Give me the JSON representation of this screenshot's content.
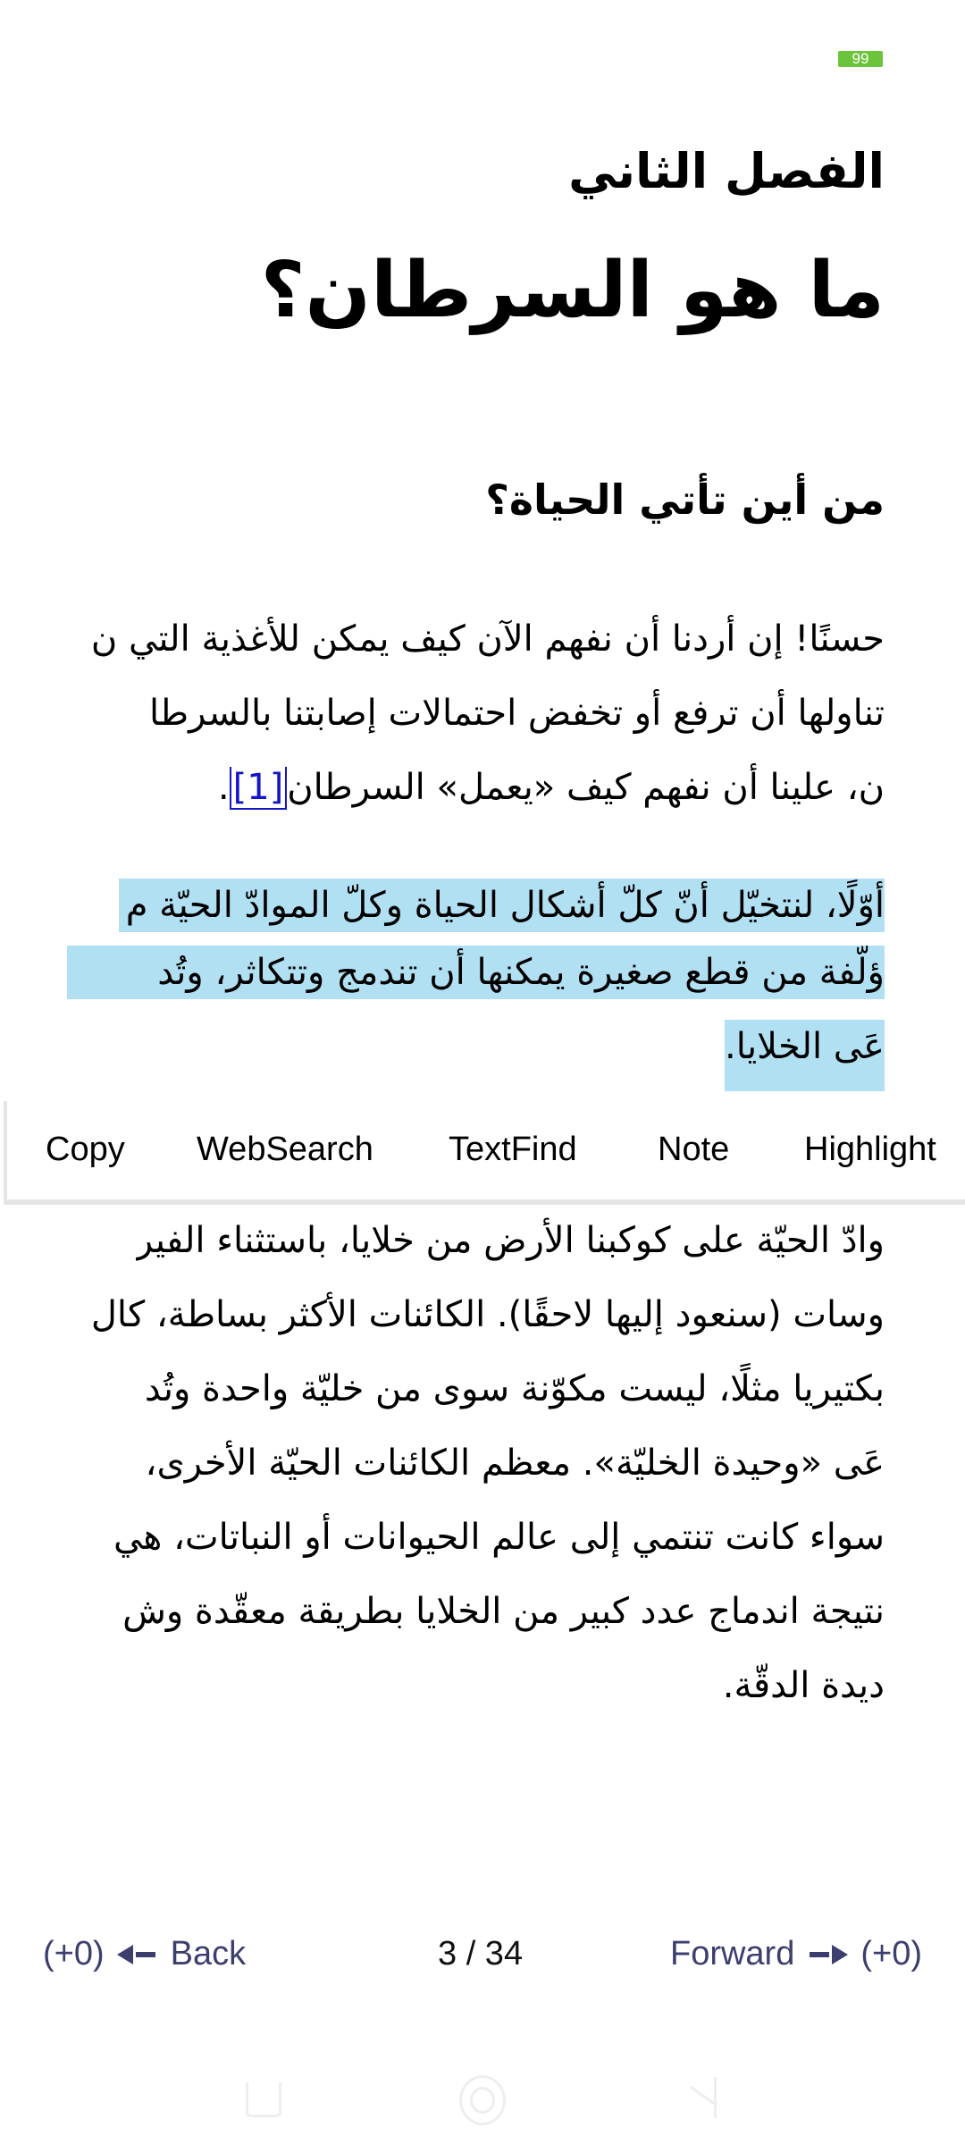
{
  "status": {
    "battery": "99",
    "battery_color": "#6cc43a"
  },
  "book": {
    "chapter_label": "الفصل الثاني",
    "chapter_title": "ما هو السرطان؟",
    "section_title": "من أين تأتي الحياة؟",
    "paragraph1": [
      "حسنًا! إن أردنا أن نفهم الآن كيف يمكن للأغذية التي ن",
      "تناولها أن ترفع أو تخفض احتمالات إصابتنا بالسرطا",
      "ن، علينا أن نفهم كيف «يعمل» السرطان"
    ],
    "footnote_ref": "[1]",
    "footnote_trailing": ".",
    "paragraph2_selected": [
      "أوّلًا، لنتخيّل أنّ كلّ أشكال الحياة وكلّ الموادّ الحيّة م",
      "ؤلّفة من قطع صغيرة يمكنها أن تندمج وتتكاثر، وتُد",
      "عَى الخلايا."
    ],
    "paragraph3": [
      "وادّ الحيّة على كوكبنا الأرض من خلايا، باستثناء الفير",
      "وسات (سنعود إليها لاحقًا). الكائنات الأكثر بساطة، كال",
      "بكتيريا مثلًا، ليست مكوّنة سوى من خليّة واحدة وتُد",
      "عَى «وحيدة الخليّة». معظم الكائنات الحيّة الأخرى،",
      "سواء كانت تنتمي إلى عالم الحيوانات أو النباتات، هي",
      "نتيجة اندماج عدد كبير من الخلايا بطريقة معقّدة وش",
      "ديدة الدقّة."
    ],
    "selection_color": "#b1e0f3",
    "link_color": "#1515c8"
  },
  "selection_menu": {
    "items": [
      "Copy",
      "WebSearch",
      "TextFind",
      "Note",
      "Highlight"
    ]
  },
  "navigation": {
    "back_count": "(+0)",
    "back_label": "Back",
    "page_indicator": "3 / 34",
    "forward_label": "Forward",
    "forward_count": "(+0)",
    "nav_color": "#3c3f6e"
  }
}
